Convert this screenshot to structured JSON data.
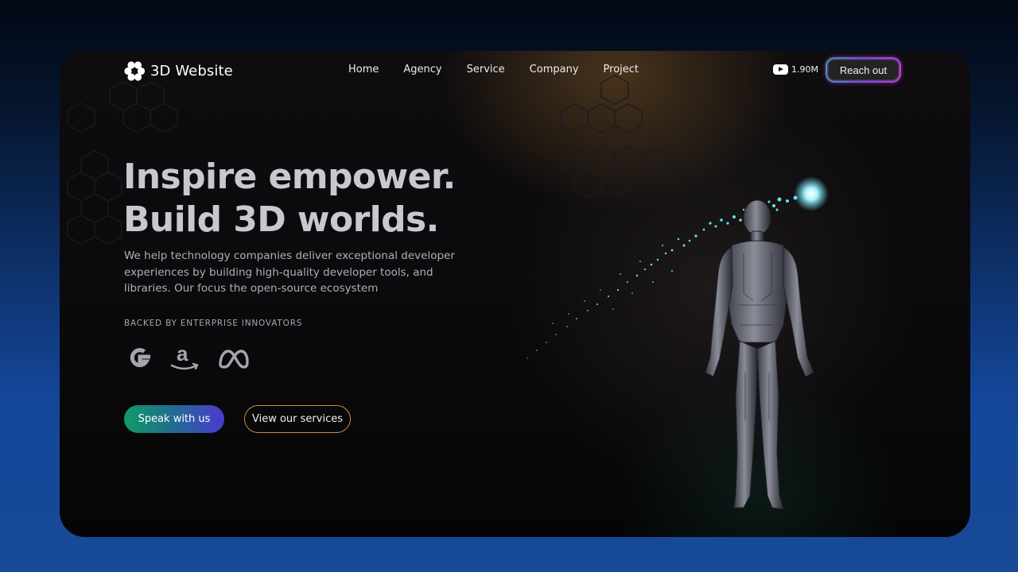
{
  "brand": {
    "name": "3D Website",
    "logo_icon": "hexagon-cluster-icon"
  },
  "nav": {
    "items": [
      {
        "label": "Home"
      },
      {
        "label": "Agency"
      },
      {
        "label": "Service"
      },
      {
        "label": "Company"
      },
      {
        "label": "Project"
      }
    ]
  },
  "header": {
    "youtube_count": "1.90M",
    "youtube_icon": "youtube-icon",
    "cta_label": "Reach out"
  },
  "hero": {
    "headline_line1": "Inspire empower.",
    "headline_line2": "Build 3D worlds.",
    "description": "We help technology companies deliver exceptional developer experiences by building high-quality developer tools, and libraries. Our focus the open-source ecosystem",
    "backed_label": "BACKED BY ENTERPRISE INNOVATORS",
    "partners": [
      "google-logo",
      "amazon-logo",
      "meta-logo"
    ],
    "primary_button": "Speak with us",
    "secondary_button": "View our services"
  },
  "colors": {
    "accent_green": "#129a67",
    "accent_purple": "#4b3ad0",
    "outline_gold": "#c8903c",
    "particle_cyan": "#5fe3f0"
  }
}
